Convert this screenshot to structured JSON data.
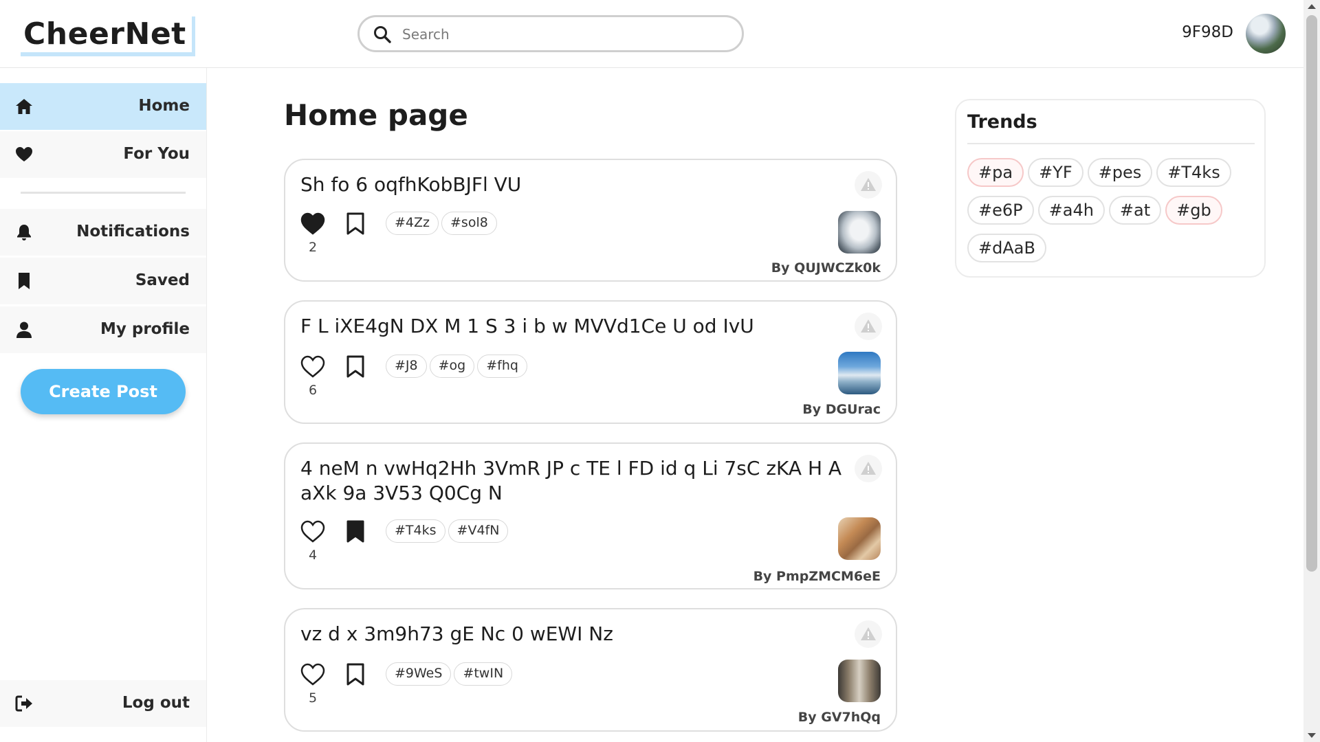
{
  "app": {
    "logo": "CheerNet"
  },
  "header": {
    "search_placeholder": "Search",
    "username": "9F98D"
  },
  "sidebar": {
    "items": [
      {
        "label": "Home",
        "icon": "home-icon"
      },
      {
        "label": "For You",
        "icon": "heart-icon"
      },
      {
        "label": "Notifications",
        "icon": "bell-icon"
      },
      {
        "label": "Saved",
        "icon": "bookmark-icon"
      },
      {
        "label": "My profile",
        "icon": "user-icon"
      }
    ],
    "create_post": "Create Post",
    "logout": "Log out"
  },
  "main": {
    "title": "Home page",
    "posts": [
      {
        "text": "Sh fo 6 oqfhKobBJFl VU",
        "likes": "2",
        "liked": true,
        "saved": false,
        "tags": [
          "#4Zz",
          "#sol8"
        ],
        "author": "By QUJWCZk0k"
      },
      {
        "text": "F L iXE4gN DX M 1 S 3 i b w MVVd1Ce U od IvU",
        "likes": "6",
        "liked": false,
        "saved": false,
        "tags": [
          "#J8",
          "#og",
          "#fhq"
        ],
        "author": "By DGUrac"
      },
      {
        "text": "4 neM n vwHq2Hh 3VmR JP c TE l FD id q Li 7sC zKA H A aXk 9a 3V53 Q0Cg N",
        "likes": "4",
        "liked": false,
        "saved": true,
        "tags": [
          "#T4ks",
          "#V4fN"
        ],
        "author": "By PmpZMCM6eE"
      },
      {
        "text": "vz d x 3m9h73 gE Nc 0 wEWI Nz",
        "likes": "5",
        "liked": false,
        "saved": false,
        "tags": [
          "#9WeS",
          "#twIN"
        ],
        "author": "By GV7hQq"
      }
    ]
  },
  "trends": {
    "title": "Trends",
    "tags": [
      "#pa",
      "#YF",
      "#pes",
      "#T4ks",
      "#e6P",
      "#a4h",
      "#at",
      "#gb",
      "#dAaB"
    ]
  },
  "colors": {
    "accent": "#55bbf4",
    "active_nav": "#c9e8fb",
    "hot_tag_border": "#f6c8c8"
  }
}
